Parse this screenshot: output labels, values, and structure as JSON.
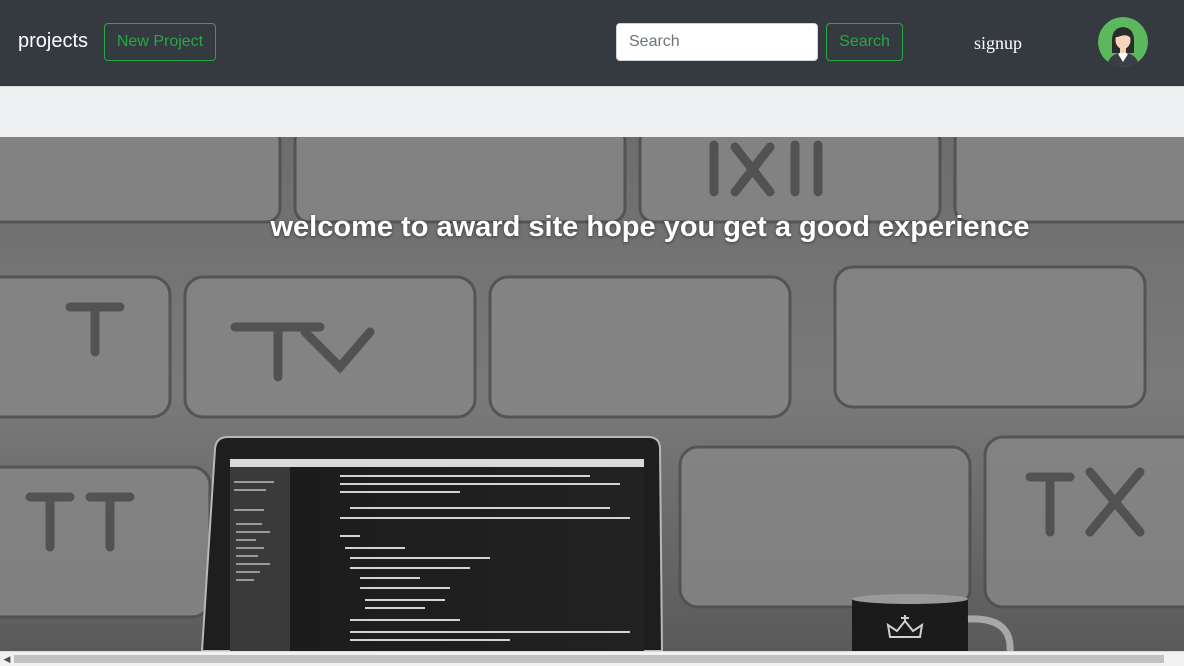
{
  "navbar": {
    "brand": "projects",
    "new_project_label": "New Project",
    "search_placeholder": "Search",
    "search_button_label": "Search",
    "signup_label": "signup",
    "colors": {
      "background": "#343a40",
      "accent": "#28a745"
    }
  },
  "hero": {
    "title": "welcome to award site hope you get a good experience"
  },
  "icons": {
    "avatar": "user-avatar-icon",
    "scroll_left": "chevron-left-icon"
  }
}
